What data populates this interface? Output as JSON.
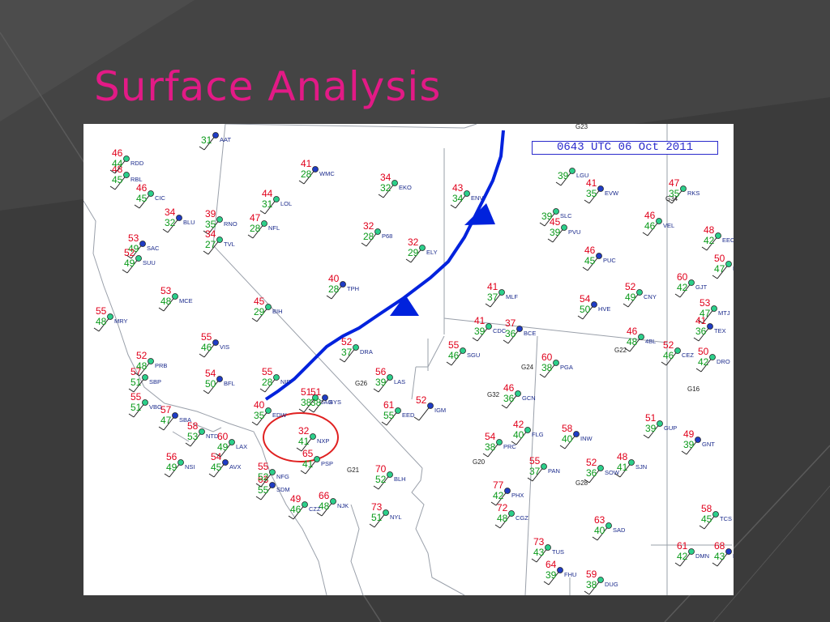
{
  "slide": {
    "title": "Surface Analysis"
  },
  "map": {
    "timestamp": "0643 UTC 06 Oct 2011",
    "colors": {
      "temperature": "#e0001b",
      "dewpoint": "#0a9a1a",
      "station_id": "#1a2a8c",
      "front": "#0022dd",
      "highlight_circle": "#e02020",
      "title": "#e21a86"
    },
    "front_type": "cold-front",
    "stations": [
      {
        "id": "AAT",
        "temp": "",
        "dew": "31"
      },
      {
        "id": "RBL",
        "temp": "48",
        "dew": "45"
      },
      {
        "id": "CIC",
        "temp": "46",
        "dew": "45"
      },
      {
        "id": "RDD",
        "temp": "46",
        "dew": "44"
      },
      {
        "id": "BLU",
        "temp": "34",
        "dew": "32"
      },
      {
        "id": "RNO",
        "temp": "39",
        "dew": "35"
      },
      {
        "id": "NFL",
        "temp": "47",
        "dew": "28"
      },
      {
        "id": "LOL",
        "temp": "44",
        "dew": "31"
      },
      {
        "id": "WMC",
        "temp": "41",
        "dew": "28"
      },
      {
        "id": "EKO",
        "temp": "34",
        "dew": "32"
      },
      {
        "id": "ENV",
        "temp": "43",
        "dew": "34"
      },
      {
        "id": "TVL",
        "temp": "34",
        "dew": "27"
      },
      {
        "id": "SAC",
        "temp": "53",
        "dew": "49"
      },
      {
        "id": "SUU",
        "temp": "52",
        "dew": "49"
      },
      {
        "id": "P68",
        "temp": "32",
        "dew": "28"
      },
      {
        "id": "ELY",
        "temp": "32",
        "dew": "29"
      },
      {
        "id": "TPH",
        "temp": "40",
        "dew": "28"
      },
      {
        "id": "MCE",
        "temp": "53",
        "dew": "48"
      },
      {
        "id": "MRY",
        "temp": "55",
        "dew": "48"
      },
      {
        "id": "BIH",
        "temp": "45",
        "dew": "29"
      },
      {
        "id": "VIS",
        "temp": "55",
        "dew": "46"
      },
      {
        "id": "DRA",
        "temp": "52",
        "dew": "37"
      },
      {
        "id": "LAS",
        "temp": "56",
        "dew": "39"
      },
      {
        "id": "NID",
        "temp": "55",
        "dew": "28"
      },
      {
        "id": "BFL",
        "temp": "54",
        "dew": "50"
      },
      {
        "id": "DAG",
        "temp": "51",
        "dew": "38"
      },
      {
        "id": "EDW",
        "temp": "40",
        "dew": "35"
      },
      {
        "id": "EED",
        "temp": "61",
        "dew": "55"
      },
      {
        "id": "IGM",
        "temp": "52",
        "dew": ""
      },
      {
        "id": "NXP",
        "temp": "32",
        "dew": "41"
      },
      {
        "id": "PSP",
        "temp": "65",
        "dew": "41"
      },
      {
        "id": "BLH",
        "temp": "70",
        "dew": "52"
      },
      {
        "id": "SDM",
        "temp": "63",
        "dew": "55"
      },
      {
        "id": "NJK",
        "temp": "66",
        "dew": "48"
      },
      {
        "id": "CZZ",
        "temp": "49",
        "dew": "46"
      },
      {
        "id": "NYL",
        "temp": "73",
        "dew": "51"
      },
      {
        "id": "PHX",
        "temp": "77",
        "dew": "42"
      },
      {
        "id": "CGZ",
        "temp": "72",
        "dew": "48"
      },
      {
        "id": "TUS",
        "temp": "73",
        "dew": "43"
      },
      {
        "id": "DUG",
        "temp": "59",
        "dew": "38"
      },
      {
        "id": "FHU",
        "temp": "64",
        "dew": "39"
      },
      {
        "id": "SAD",
        "temp": "63",
        "dew": "40"
      },
      {
        "id": "PAN",
        "temp": "55",
        "dew": "37"
      },
      {
        "id": "SOW",
        "temp": "52",
        "dew": "36"
      },
      {
        "id": "INW",
        "temp": "58",
        "dew": "40"
      },
      {
        "id": "FLG",
        "temp": "42",
        "dew": "40"
      },
      {
        "id": "GCN",
        "temp": "46",
        "dew": "36"
      },
      {
        "id": "PGA",
        "temp": "60",
        "dew": "38"
      },
      {
        "id": "BCE",
        "temp": "37",
        "dew": "36"
      },
      {
        "id": "CDC",
        "temp": "41",
        "dew": "39"
      },
      {
        "id": "MLF",
        "temp": "41",
        "dew": "37"
      },
      {
        "id": "SGU",
        "temp": "55",
        "dew": "46"
      },
      {
        "id": "PUC",
        "temp": "46",
        "dew": "45"
      },
      {
        "id": "PVU",
        "temp": "45",
        "dew": "39"
      },
      {
        "id": "SLC",
        "temp": "",
        "dew": "39"
      },
      {
        "id": "LGU",
        "temp": "",
        "dew": "39"
      },
      {
        "id": "EVW",
        "temp": "41",
        "dew": "35"
      },
      {
        "id": "RKS",
        "temp": "47",
        "dew": "35"
      },
      {
        "id": "VEL",
        "temp": "46",
        "dew": "46"
      },
      {
        "id": "CNY",
        "temp": "52",
        "dew": "49"
      },
      {
        "id": "HVE",
        "temp": "54",
        "dew": "50"
      },
      {
        "id": "4BL",
        "temp": "46",
        "dew": "48"
      },
      {
        "id": "GJT",
        "temp": "60",
        "dew": "42"
      },
      {
        "id": "MTJ",
        "temp": "53",
        "dew": "47"
      },
      {
        "id": "TEX",
        "temp": "41",
        "dew": "36"
      },
      {
        "id": "CEZ",
        "temp": "52",
        "dew": "46"
      },
      {
        "id": "DRO",
        "temp": "50",
        "dew": "42"
      },
      {
        "id": "GUP",
        "temp": "51",
        "dew": "39"
      },
      {
        "id": "GNT",
        "temp": "49",
        "dew": "39"
      },
      {
        "id": "SJN",
        "temp": "48",
        "dew": "41"
      },
      {
        "id": "TCS",
        "temp": "58",
        "dew": "45"
      },
      {
        "id": "DMN",
        "temp": "61",
        "dew": "42"
      },
      {
        "id": "LRU",
        "temp": "68",
        "dew": "43"
      },
      {
        "id": "EEO",
        "temp": "48",
        "dew": "42"
      },
      {
        "id": "RIL",
        "temp": "50",
        "dew": "47"
      },
      {
        "id": "NSI",
        "temp": "56",
        "dew": "49"
      },
      {
        "id": "AVX",
        "temp": "54",
        "dew": "45"
      },
      {
        "id": "NFG",
        "temp": "55",
        "dew": "52"
      },
      {
        "id": "NTD",
        "temp": "58",
        "dew": "53"
      },
      {
        "id": "LAX",
        "temp": "60",
        "dew": "49"
      },
      {
        "id": "SBA",
        "temp": "57",
        "dew": "47"
      },
      {
        "id": "VBG",
        "temp": "55",
        "dew": "51"
      },
      {
        "id": "SBP",
        "temp": "57",
        "dew": "51"
      },
      {
        "id": "PRB",
        "temp": "52",
        "dew": "48"
      },
      {
        "id": "BYS",
        "temp": "51",
        "dew": "38"
      },
      {
        "id": "PRC",
        "temp": "54",
        "dew": "38"
      }
    ],
    "grid_labels": [
      "G23",
      "G34",
      "G24",
      "G26",
      "G16",
      "G20",
      "G21",
      "G22",
      "G28",
      "G32"
    ]
  }
}
